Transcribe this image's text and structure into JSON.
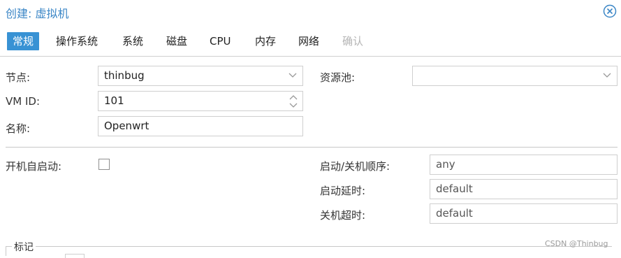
{
  "dialog": {
    "title": "创建: 虚拟机",
    "close_icon": "close-circle-icon"
  },
  "tabs": [
    {
      "label": "常规",
      "state": "active"
    },
    {
      "label": "操作系统",
      "state": "normal"
    },
    {
      "label": "系统",
      "state": "normal"
    },
    {
      "label": "磁盘",
      "state": "normal"
    },
    {
      "label": "CPU",
      "state": "normal"
    },
    {
      "label": "内存",
      "state": "normal"
    },
    {
      "label": "网络",
      "state": "normal"
    },
    {
      "label": "确认",
      "state": "disabled"
    }
  ],
  "form": {
    "node": {
      "label": "节点:",
      "value": "thinbug"
    },
    "vmid": {
      "label": "VM ID:",
      "value": "101"
    },
    "name": {
      "label": "名称:",
      "value": "Openwrt"
    },
    "pool": {
      "label": "资源池:",
      "value": ""
    },
    "onboot": {
      "label": "开机自启动:",
      "checked": false
    },
    "startup_order": {
      "label": "启动/关机顺序:",
      "value": "any"
    },
    "startup_delay": {
      "label": "启动延时:",
      "value": "default"
    },
    "shutdown_timeout": {
      "label": "关机超时:",
      "value": "default"
    },
    "tags": {
      "legend": "标记"
    }
  },
  "watermark": "CSDN @Thinbug",
  "colors": {
    "accent": "#3892d4",
    "title": "#3b86c6",
    "border": "#cfcfcf"
  }
}
